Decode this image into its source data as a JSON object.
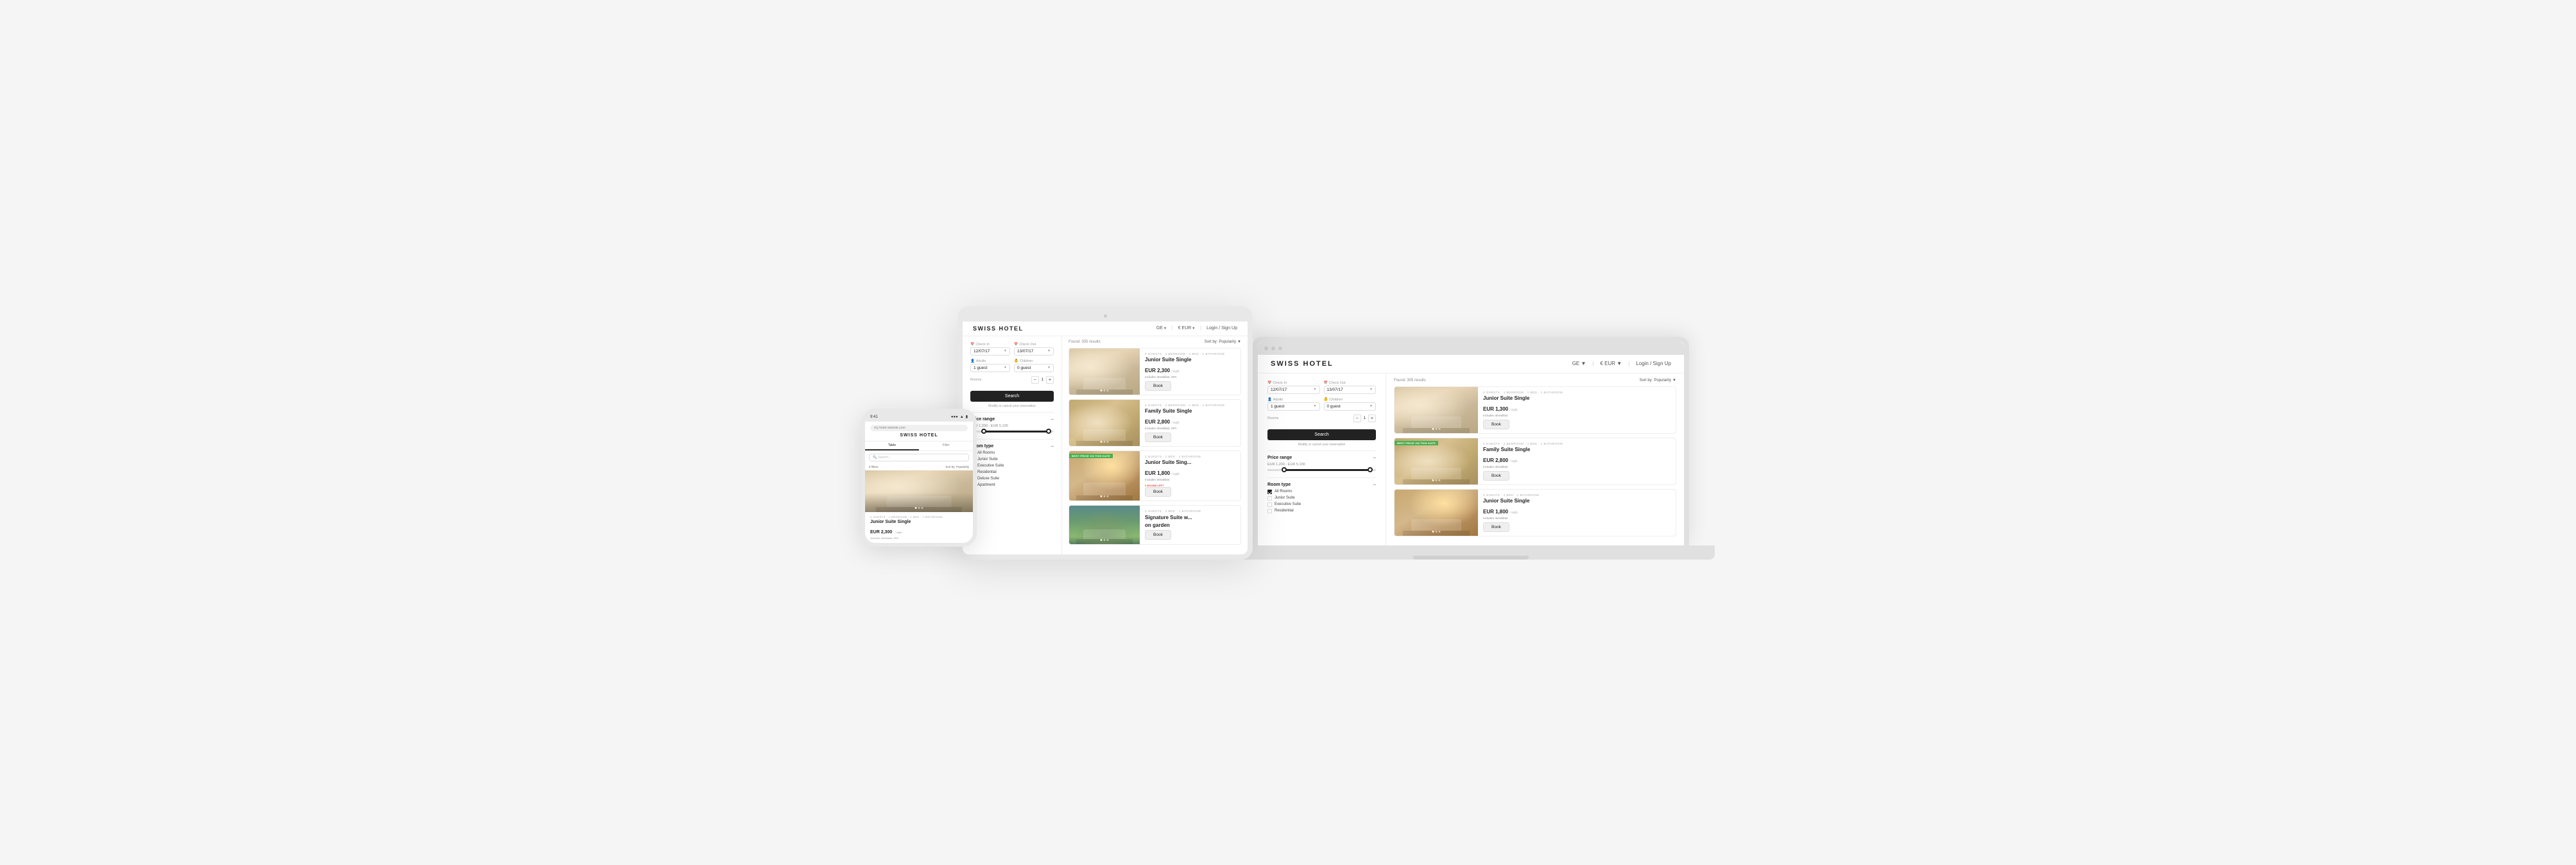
{
  "phone": {
    "time": "9:41",
    "signal": "▲ ● ●",
    "brand": "SWISS HOTEL",
    "url": "my-hotel-website.com",
    "tabs": [
      "Table",
      "Filter"
    ],
    "active_tab": "Table",
    "search_placeholder": "Search...",
    "filter_label": "5 filters",
    "sort_label": "Sort by: Popularity",
    "room_meta": "2 GUESTS · 1 BEDROOM · 1 BED · 1 BATHROOM",
    "room_name": "Junior Suite Single",
    "room_price": "EUR 2,300",
    "room_price_sub": "/ night",
    "room_includes": "Includes: Breakfast, SPA"
  },
  "tablet": {
    "brand": "SWISS HOTEL",
    "nav": {
      "lang": "GE",
      "currency": "€ EUR",
      "login": "Login / Sign Up"
    },
    "sidebar": {
      "checkin_label": "Check In",
      "checkout_label": "Check Out",
      "checkin_value": "12/07/17",
      "checkout_value": "13/07/17",
      "adults_label": "Adults",
      "children_label": "Children",
      "adults_value": "1 guest",
      "children_value": "0 guest",
      "rooms_label": "Rooms",
      "rooms_value": "1",
      "search_btn": "Search",
      "modify_link": "Modify or cancel your reservation",
      "price_range_title": "Price range",
      "price_range_values": "EUR 1,200 - EUR 5,100",
      "price_range_avg": "Average nightly rate",
      "room_type_title": "Room type",
      "room_types": [
        {
          "label": "All Rooms",
          "checked": true
        },
        {
          "label": "Junior Suite",
          "checked": false
        },
        {
          "label": "Executive Suite",
          "checked": false
        },
        {
          "label": "Residential",
          "checked": false
        },
        {
          "label": "Deluxe Suite",
          "checked": false
        },
        {
          "label": "Apartment",
          "checked": false
        }
      ]
    },
    "results": {
      "count": "Found: 305 results",
      "sort_label": "Sort by:",
      "sort_value": "Popularity",
      "rooms": [
        {
          "meta": "2 GUESTS · 1 BEDROOM · 1 BED · 1 BATHROOM",
          "name": "Junior Suite Single",
          "price": "EUR 2,300",
          "price_sub": "/ night",
          "includes": "Includes: Breakfast, SPA",
          "book_label": "Book",
          "image_type": "light",
          "best_price": false,
          "rooms_left": ""
        },
        {
          "meta": "4 GUESTS · 2 BEDROOM · 1 BED · 1 BATHROOM",
          "name": "Family Suite Single",
          "price": "EUR 2,800",
          "price_sub": "/ night",
          "includes": "Includes: Breakfast, SPA",
          "book_label": "Book",
          "image_type": "warm",
          "best_price": false,
          "rooms_left": ""
        },
        {
          "meta": "2 GUESTS · 1 BED · 1 BATHROOM",
          "name": "Junior Suite Sing...",
          "price": "EUR 1,800",
          "price_sub": "/ night",
          "includes": "Includes: Breakfast",
          "book_label": "Book",
          "image_type": "cool",
          "best_price": true,
          "best_price_label": "BEST PRICE ON THIS DATE",
          "rooms_left": "2 ROOMS LEFT"
        },
        {
          "meta": "4 GUESTS · 2 BED · 1 BATHROOM",
          "name": "Signature Suite w...",
          "name2": "on garden",
          "price": "",
          "price_sub": "",
          "includes": "",
          "book_label": "Book",
          "image_type": "green",
          "best_price": false,
          "rooms_left": ""
        }
      ]
    }
  },
  "laptop": {
    "brand": "SWISS HOTEL",
    "nav": {
      "lang": "GE",
      "currency": "€ EUR",
      "login": "Login / Sign Up"
    },
    "sidebar": {
      "checkin_label": "Check In",
      "checkout_label": "Check Out",
      "checkin_value": "12/07/17",
      "checkout_value": "13/07/17",
      "adults_label": "Adults",
      "children_label": "Children",
      "adults_value": "1 guest",
      "children_value": "0 guest",
      "rooms_label": "Rooms",
      "rooms_value": "1",
      "search_btn": "Search",
      "modify_link": "Modify or cancel your reservation",
      "price_range_title": "Price range",
      "price_range_values": "EUR 1,200 - EUR 5,100",
      "room_type_title": "Room type",
      "room_types": [
        {
          "label": "All Rooms",
          "checked": true
        },
        {
          "label": "Junior Suite",
          "checked": false
        },
        {
          "label": "Executive Suite",
          "checked": false
        },
        {
          "label": "Residential",
          "checked": false
        }
      ]
    },
    "results": {
      "count": "Found: 305 results",
      "sort_label": "Sort by:",
      "sort_value": "Popularity",
      "rooms": [
        {
          "meta": "2 GUESTS · 1 BEDROOM · 1 BED · 1 BATHROOM",
          "name": "Junior Suite Single",
          "price": "EUR 1,300",
          "price_sub": "/ night",
          "includes": "Includes: Breakfast",
          "book_label": "Book",
          "image_type": "light",
          "best_price": false
        },
        {
          "meta": "4 GUESTS · 2 BEDROOM · 1 BED · 1 BATHROOM",
          "name": "Family Suite Single",
          "price": "EUR 2,800",
          "price_sub": "/ night",
          "includes": "Includes: Breakfast",
          "book_label": "Book",
          "image_type": "warm",
          "best_price": true,
          "best_price_label": "BEST PRICE ON THIS DATE"
        },
        {
          "meta": "2 GUESTS · 1 BED · 1 BATHROOM",
          "name": "Junior Suite Single",
          "price": "EUR 1,800",
          "price_sub": "/ night",
          "includes": "Includes: Breakfast",
          "book_label": "Book",
          "image_type": "cool",
          "best_price": false
        }
      ]
    }
  }
}
